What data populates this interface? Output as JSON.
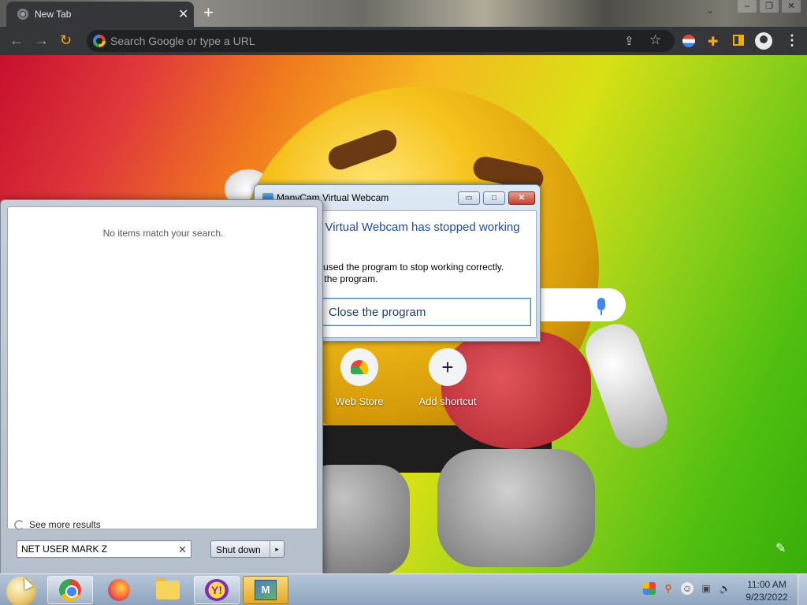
{
  "browser": {
    "tab": {
      "title": "New Tab",
      "close": "✕"
    },
    "new_tab": "+",
    "omnibox": {
      "placeholder": "Search Google or type a URL"
    },
    "menu": "⋮"
  },
  "ntp": {
    "shortcuts": [
      {
        "label": "Web Store",
        "icon": "webstore-icon"
      },
      {
        "label": "Add shortcut",
        "icon": "plus-icon",
        "glyph": "+"
      }
    ]
  },
  "error_dialog": {
    "title": "ManyCam Virtual Webcam",
    "heading": "ManyCam Virtual Webcam has stopped working",
    "message": "A problem caused the program to stop working correctly. Please close the program.",
    "close_program": "Close the program",
    "minimize": "▭",
    "maximize": "□",
    "close": "✕"
  },
  "start_menu": {
    "no_items": "No items match your search.",
    "see_more": "See more results",
    "search_value": "NET USER MARK Z",
    "clear": "✕",
    "shutdown": "Shut down",
    "shutdown_arrow": "▸"
  },
  "taskbar": {
    "apps": [
      "chrome",
      "firefox",
      "folder",
      "yahoo-messenger",
      "manycam"
    ],
    "yahoo_glyph": "Y!",
    "manycam_glyph": "M",
    "clock": {
      "time": "11:00 AM",
      "date": "9/23/2022"
    }
  },
  "colors": {
    "chrome_dark": "#35363a",
    "ntp_gradient_start": "#c8102e",
    "ntp_gradient_end": "#38ae0a",
    "dialog_heading": "#1e4aa0",
    "taskbar": "#a3b5cb"
  }
}
